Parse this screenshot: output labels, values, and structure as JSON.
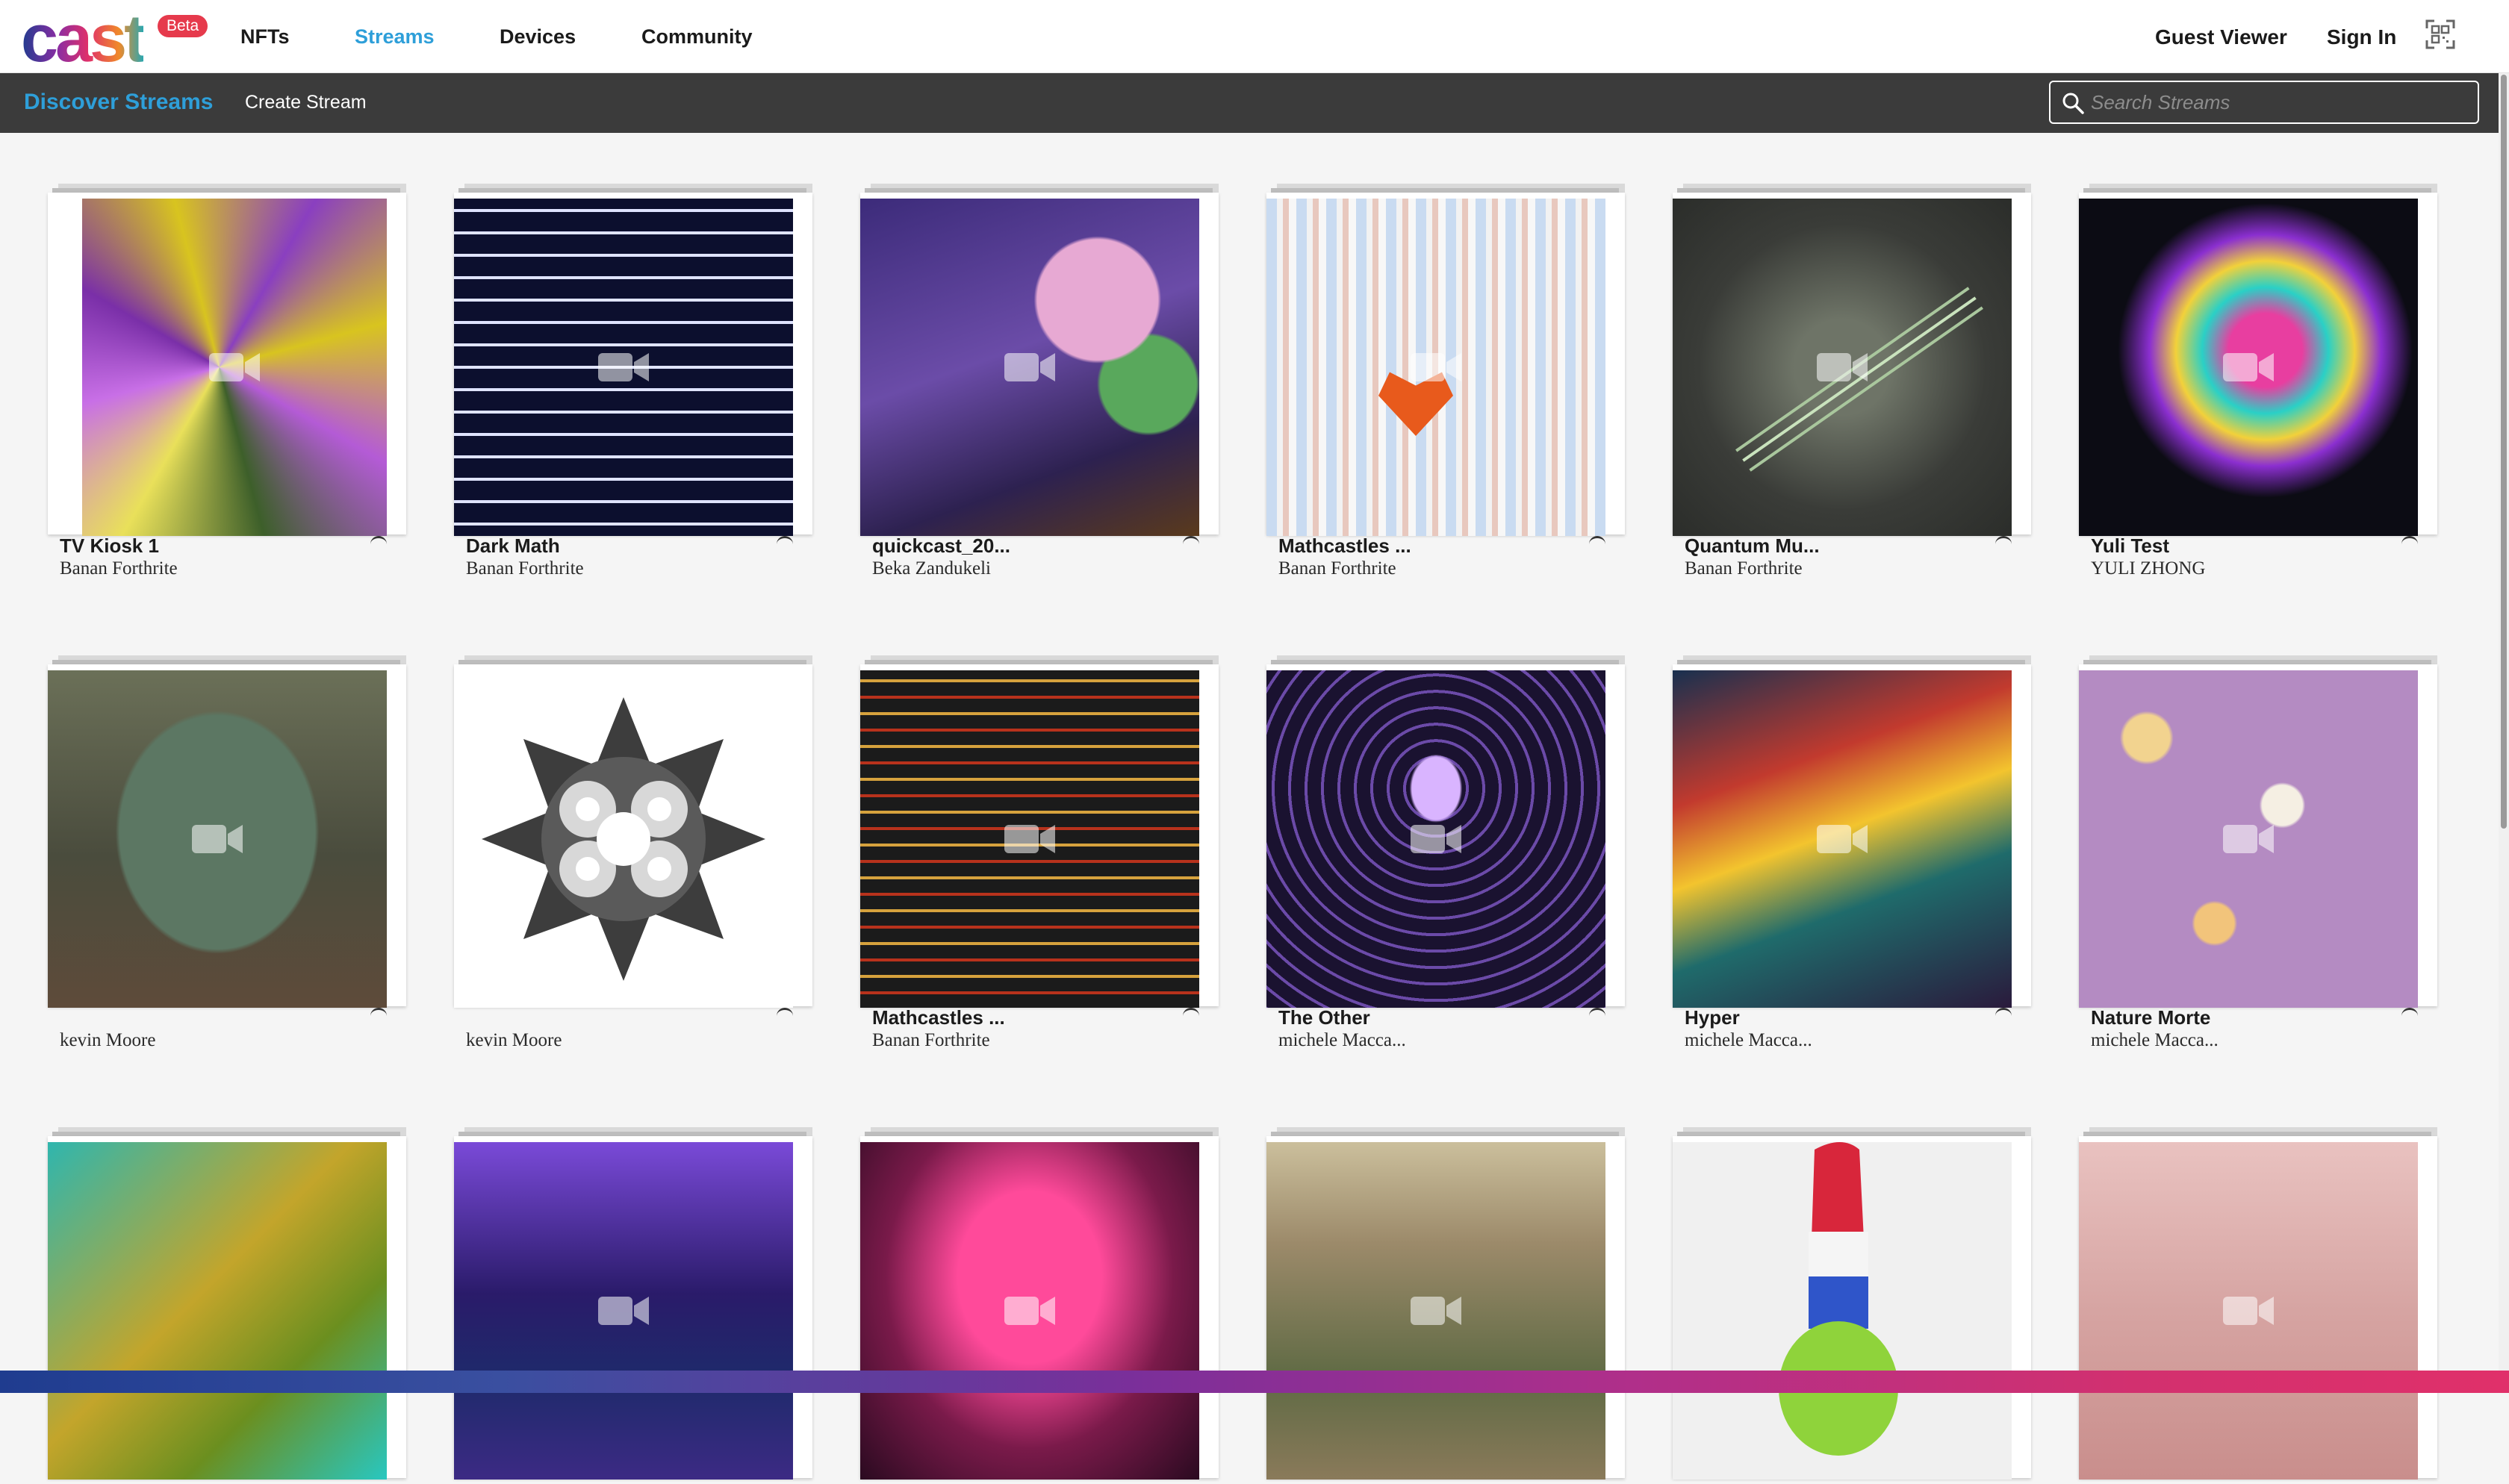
{
  "brand": {
    "logo_text": "cast",
    "badge": "Beta"
  },
  "nav": {
    "items": [
      {
        "label": "NFTs",
        "active": false
      },
      {
        "label": "Streams",
        "active": true
      },
      {
        "label": "Devices",
        "active": false
      },
      {
        "label": "Community",
        "active": false
      }
    ],
    "guest": "Guest Viewer",
    "sign_in": "Sign In"
  },
  "subnav": {
    "title": "Discover Streams",
    "create": "Create Stream",
    "search_placeholder": "Search Streams"
  },
  "colors": {
    "accent": "#2e9fd9",
    "subbar": "#3b3b3b",
    "beta": "#e63a4c"
  },
  "cards": [
    {
      "title": "TV Kiosk 1",
      "artist": "Banan Forthrite"
    },
    {
      "title": "Dark Math",
      "artist": "Banan Forthrite"
    },
    {
      "title": "quickcast_20...",
      "artist": "Beka Zandukeli"
    },
    {
      "title": "Mathcastles ...",
      "artist": "Banan Forthrite"
    },
    {
      "title": "Quantum Mu...",
      "artist": "Banan Forthrite"
    },
    {
      "title": "Yuli Test",
      "artist": "YULI ZHONG"
    },
    {
      "title": "",
      "artist": "kevin Moore"
    },
    {
      "title": "",
      "artist": "kevin Moore"
    },
    {
      "title": "Mathcastles ...",
      "artist": "Banan Forthrite"
    },
    {
      "title": "The Other",
      "artist": "michele Macca..."
    },
    {
      "title": "Hyper",
      "artist": "michele Macca..."
    },
    {
      "title": "Nature Morte",
      "artist": "michele Macca..."
    },
    {
      "title": "",
      "artist": ""
    },
    {
      "title": "",
      "artist": ""
    },
    {
      "title": "",
      "artist": ""
    },
    {
      "title": "",
      "artist": ""
    },
    {
      "title": "",
      "artist": ""
    },
    {
      "title": "",
      "artist": ""
    }
  ],
  "icons": {
    "stream_overlay": "video-camera-icon",
    "loading": "spinner-icon",
    "qr": "qr-code-icon",
    "search": "search-icon"
  }
}
